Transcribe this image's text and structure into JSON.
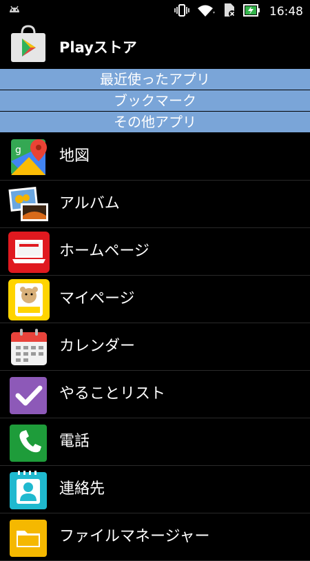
{
  "status_bar": {
    "time": "16:48",
    "icons": [
      "android-debug-icon",
      "vibrate-icon",
      "wifi-icon",
      "sim-missing-icon",
      "battery-charging-icon"
    ]
  },
  "header": {
    "title": "Playストア",
    "icon": "play-store-icon"
  },
  "sections": [
    {
      "label": "最近使ったアプリ"
    },
    {
      "label": "ブックマーク"
    },
    {
      "label": "その他アプリ"
    }
  ],
  "apps": [
    {
      "label": "地図",
      "icon": "maps-icon"
    },
    {
      "label": "アルバム",
      "icon": "album-icon"
    },
    {
      "label": "ホームページ",
      "icon": "homepage-icon"
    },
    {
      "label": "マイページ",
      "icon": "mypage-icon"
    },
    {
      "label": "カレンダー",
      "icon": "calendar-icon"
    },
    {
      "label": "やることリスト",
      "icon": "todo-list-icon"
    },
    {
      "label": "電話",
      "icon": "phone-icon"
    },
    {
      "label": "連絡先",
      "icon": "contacts-icon"
    },
    {
      "label": "ファイルマネージャー",
      "icon": "file-manager-icon"
    }
  ],
  "colors": {
    "section_bar": "#7aa5d8",
    "background": "#000000"
  }
}
